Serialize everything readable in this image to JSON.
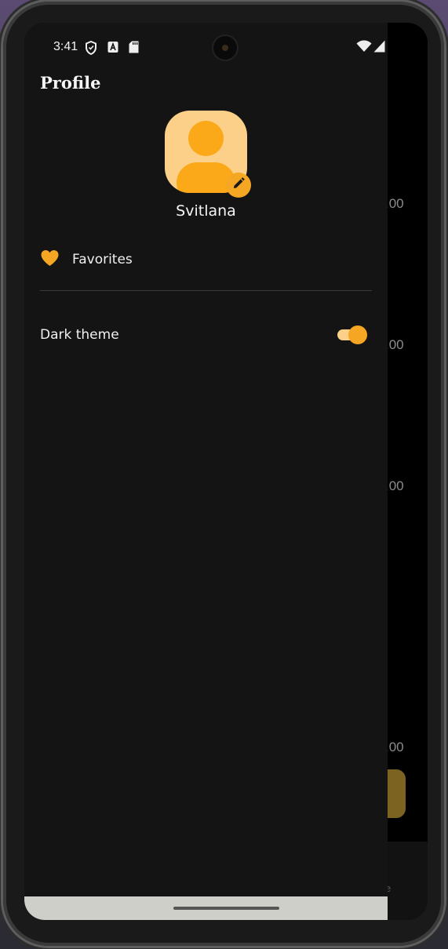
{
  "status_bar": {
    "time": "3:41",
    "left_icons": [
      "shield-icon",
      "app-a-icon",
      "sd-card-icon"
    ],
    "right_icons": [
      "wifi-icon",
      "cell-signal-icon",
      "battery-icon"
    ]
  },
  "drawer": {
    "title": "Profile",
    "user": {
      "name": "Svitlana"
    },
    "menu": {
      "favorites_label": "Favorites",
      "dark_theme_label": "Dark theme",
      "dark_theme_enabled": true
    }
  },
  "background_screen": {
    "values": [
      ".00",
      ".00",
      ".00",
      ".00"
    ],
    "bottom_text": "e"
  },
  "colors": {
    "accent": "#f5a623",
    "accent_light": "#fdd08a",
    "drawer_bg": "#141414"
  }
}
